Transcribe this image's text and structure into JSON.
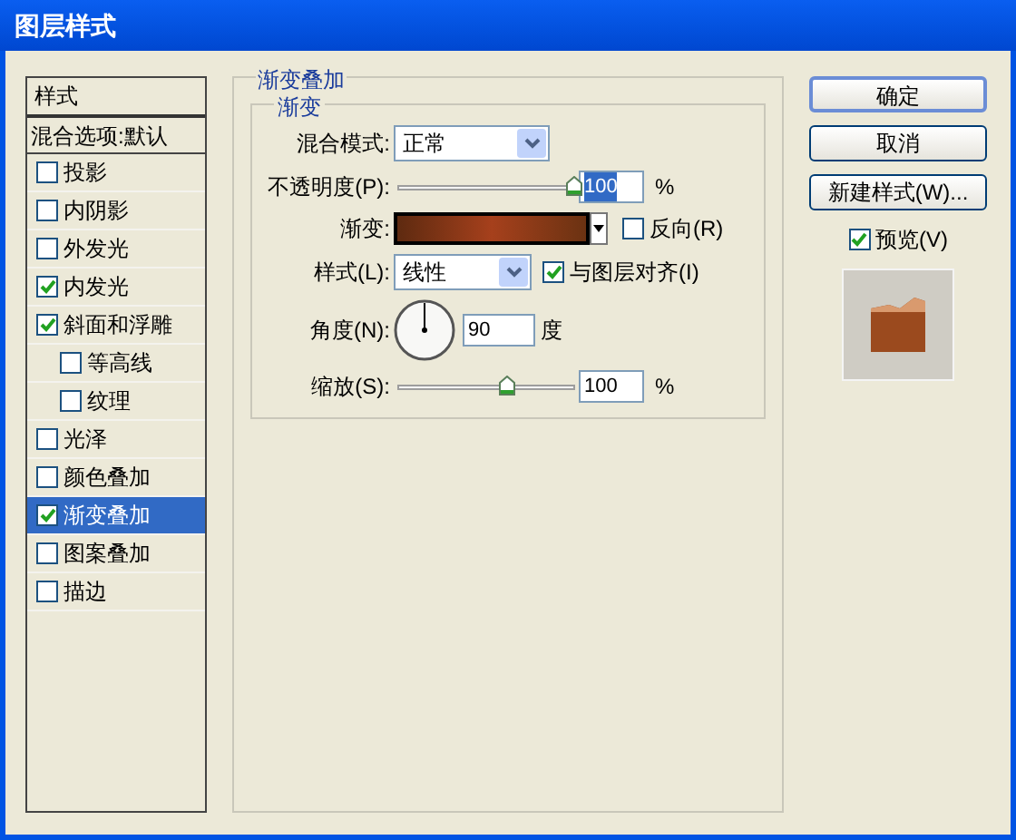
{
  "window": {
    "title": "图层样式"
  },
  "sidebar": {
    "header": "样式",
    "blend_item": "混合选项:默认",
    "items": [
      {
        "label": "投影",
        "checked": false,
        "selected": false
      },
      {
        "label": "内阴影",
        "checked": false,
        "selected": false
      },
      {
        "label": "外发光",
        "checked": false,
        "selected": false
      },
      {
        "label": "内发光",
        "checked": true,
        "selected": false
      },
      {
        "label": "斜面和浮雕",
        "checked": true,
        "selected": false,
        "children": [
          {
            "label": "等高线",
            "checked": false,
            "selected": false
          },
          {
            "label": "纹理",
            "checked": false,
            "selected": false
          }
        ]
      },
      {
        "label": "光泽",
        "checked": false,
        "selected": false
      },
      {
        "label": "颜色叠加",
        "checked": false,
        "selected": false
      },
      {
        "label": "渐变叠加",
        "checked": true,
        "selected": true
      },
      {
        "label": "图案叠加",
        "checked": false,
        "selected": false
      },
      {
        "label": "描边",
        "checked": false,
        "selected": false
      }
    ]
  },
  "panel": {
    "title": "渐变叠加",
    "group_title": "渐变",
    "blend_mode": {
      "label": "混合模式:",
      "value": "正常"
    },
    "opacity": {
      "label": "不透明度(P):",
      "level": 1.0,
      "value": "100",
      "unit": "%"
    },
    "gradient": {
      "label": "渐变:",
      "reverse": {
        "label": "反向(R)",
        "checked": false
      }
    },
    "style": {
      "label": "样式(L):",
      "value": "线性",
      "align": {
        "label": "与图层对齐(I)",
        "checked": true
      }
    },
    "angle": {
      "label": "角度(N):",
      "value": "90",
      "unit": "度"
    },
    "scale": {
      "label": "缩放(S):",
      "level": 0.62,
      "value": "100",
      "unit": "%"
    }
  },
  "buttons": [
    {
      "label": "确定",
      "default": true
    },
    {
      "label": "取消",
      "default": false
    },
    {
      "label": "新建样式(W)...",
      "default": false
    }
  ],
  "preview": {
    "label": "预览(V)",
    "checked": true
  }
}
